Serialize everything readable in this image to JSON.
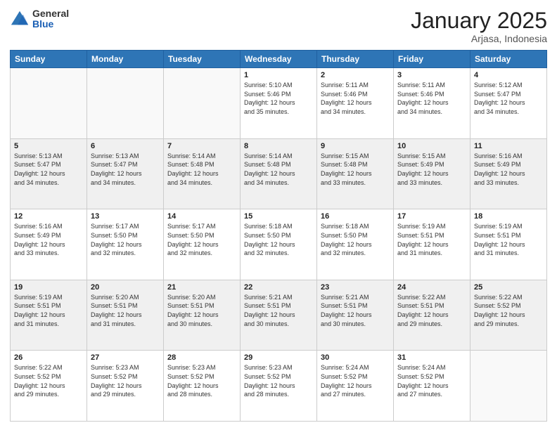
{
  "logo": {
    "general": "General",
    "blue": "Blue"
  },
  "title": "January 2025",
  "subtitle": "Arjasa, Indonesia",
  "days_of_week": [
    "Sunday",
    "Monday",
    "Tuesday",
    "Wednesday",
    "Thursday",
    "Friday",
    "Saturday"
  ],
  "weeks": [
    [
      {
        "day": "",
        "info": ""
      },
      {
        "day": "",
        "info": ""
      },
      {
        "day": "",
        "info": ""
      },
      {
        "day": "1",
        "info": "Sunrise: 5:10 AM\nSunset: 5:46 PM\nDaylight: 12 hours\nand 35 minutes."
      },
      {
        "day": "2",
        "info": "Sunrise: 5:11 AM\nSunset: 5:46 PM\nDaylight: 12 hours\nand 34 minutes."
      },
      {
        "day": "3",
        "info": "Sunrise: 5:11 AM\nSunset: 5:46 PM\nDaylight: 12 hours\nand 34 minutes."
      },
      {
        "day": "4",
        "info": "Sunrise: 5:12 AM\nSunset: 5:47 PM\nDaylight: 12 hours\nand 34 minutes."
      }
    ],
    [
      {
        "day": "5",
        "info": "Sunrise: 5:13 AM\nSunset: 5:47 PM\nDaylight: 12 hours\nand 34 minutes."
      },
      {
        "day": "6",
        "info": "Sunrise: 5:13 AM\nSunset: 5:47 PM\nDaylight: 12 hours\nand 34 minutes."
      },
      {
        "day": "7",
        "info": "Sunrise: 5:14 AM\nSunset: 5:48 PM\nDaylight: 12 hours\nand 34 minutes."
      },
      {
        "day": "8",
        "info": "Sunrise: 5:14 AM\nSunset: 5:48 PM\nDaylight: 12 hours\nand 34 minutes."
      },
      {
        "day": "9",
        "info": "Sunrise: 5:15 AM\nSunset: 5:48 PM\nDaylight: 12 hours\nand 33 minutes."
      },
      {
        "day": "10",
        "info": "Sunrise: 5:15 AM\nSunset: 5:49 PM\nDaylight: 12 hours\nand 33 minutes."
      },
      {
        "day": "11",
        "info": "Sunrise: 5:16 AM\nSunset: 5:49 PM\nDaylight: 12 hours\nand 33 minutes."
      }
    ],
    [
      {
        "day": "12",
        "info": "Sunrise: 5:16 AM\nSunset: 5:49 PM\nDaylight: 12 hours\nand 33 minutes."
      },
      {
        "day": "13",
        "info": "Sunrise: 5:17 AM\nSunset: 5:50 PM\nDaylight: 12 hours\nand 32 minutes."
      },
      {
        "day": "14",
        "info": "Sunrise: 5:17 AM\nSunset: 5:50 PM\nDaylight: 12 hours\nand 32 minutes."
      },
      {
        "day": "15",
        "info": "Sunrise: 5:18 AM\nSunset: 5:50 PM\nDaylight: 12 hours\nand 32 minutes."
      },
      {
        "day": "16",
        "info": "Sunrise: 5:18 AM\nSunset: 5:50 PM\nDaylight: 12 hours\nand 32 minutes."
      },
      {
        "day": "17",
        "info": "Sunrise: 5:19 AM\nSunset: 5:51 PM\nDaylight: 12 hours\nand 31 minutes."
      },
      {
        "day": "18",
        "info": "Sunrise: 5:19 AM\nSunset: 5:51 PM\nDaylight: 12 hours\nand 31 minutes."
      }
    ],
    [
      {
        "day": "19",
        "info": "Sunrise: 5:19 AM\nSunset: 5:51 PM\nDaylight: 12 hours\nand 31 minutes."
      },
      {
        "day": "20",
        "info": "Sunrise: 5:20 AM\nSunset: 5:51 PM\nDaylight: 12 hours\nand 31 minutes."
      },
      {
        "day": "21",
        "info": "Sunrise: 5:20 AM\nSunset: 5:51 PM\nDaylight: 12 hours\nand 30 minutes."
      },
      {
        "day": "22",
        "info": "Sunrise: 5:21 AM\nSunset: 5:51 PM\nDaylight: 12 hours\nand 30 minutes."
      },
      {
        "day": "23",
        "info": "Sunrise: 5:21 AM\nSunset: 5:51 PM\nDaylight: 12 hours\nand 30 minutes."
      },
      {
        "day": "24",
        "info": "Sunrise: 5:22 AM\nSunset: 5:51 PM\nDaylight: 12 hours\nand 29 minutes."
      },
      {
        "day": "25",
        "info": "Sunrise: 5:22 AM\nSunset: 5:52 PM\nDaylight: 12 hours\nand 29 minutes."
      }
    ],
    [
      {
        "day": "26",
        "info": "Sunrise: 5:22 AM\nSunset: 5:52 PM\nDaylight: 12 hours\nand 29 minutes."
      },
      {
        "day": "27",
        "info": "Sunrise: 5:23 AM\nSunset: 5:52 PM\nDaylight: 12 hours\nand 29 minutes."
      },
      {
        "day": "28",
        "info": "Sunrise: 5:23 AM\nSunset: 5:52 PM\nDaylight: 12 hours\nand 28 minutes."
      },
      {
        "day": "29",
        "info": "Sunrise: 5:23 AM\nSunset: 5:52 PM\nDaylight: 12 hours\nand 28 minutes."
      },
      {
        "day": "30",
        "info": "Sunrise: 5:24 AM\nSunset: 5:52 PM\nDaylight: 12 hours\nand 27 minutes."
      },
      {
        "day": "31",
        "info": "Sunrise: 5:24 AM\nSunset: 5:52 PM\nDaylight: 12 hours\nand 27 minutes."
      },
      {
        "day": "",
        "info": ""
      }
    ]
  ]
}
